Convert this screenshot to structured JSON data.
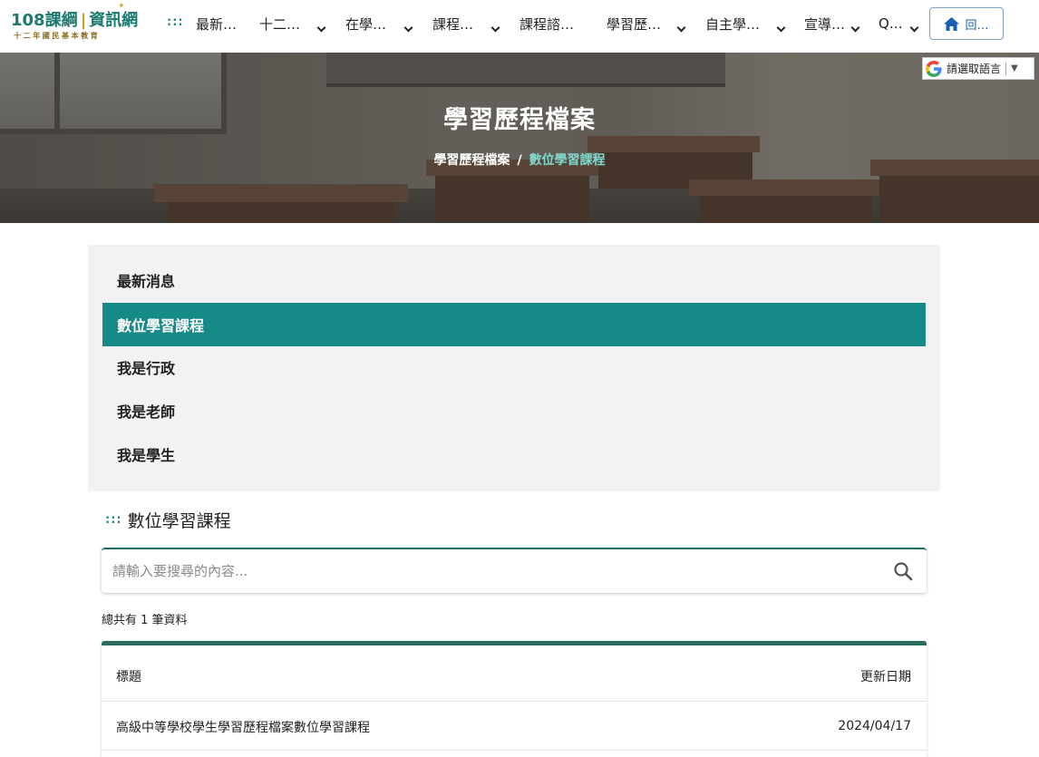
{
  "header": {
    "logo_main": "108課綱",
    "logo_main2": "資訊網",
    "logo_sub": "十二年國民基本教育",
    "nav_dots": ":::",
    "nav": [
      {
        "label": "最新…"
      },
      {
        "label": "十二…"
      },
      {
        "label": "在學…"
      },
      {
        "label": "課程…"
      },
      {
        "label": "課程諮…"
      },
      {
        "label": "學習歷…"
      },
      {
        "label": "自主學…"
      },
      {
        "label": "宣導…"
      },
      {
        "label": "Q…"
      }
    ],
    "home_label": "回…"
  },
  "banner": {
    "title": "學習歷程檔案",
    "breadcrumb": [
      "學習歷程檔案",
      "數位學習課程"
    ],
    "slash": "/"
  },
  "language": {
    "label": "請選取語言",
    "arrow": "▼"
  },
  "menu": {
    "items": [
      {
        "label": "最新消息",
        "active": false
      },
      {
        "label": "數位學習課程",
        "active": true
      },
      {
        "label": "我是行政",
        "active": false
      },
      {
        "label": "我是老師",
        "active": false
      },
      {
        "label": "我是學生",
        "active": false
      }
    ]
  },
  "section": {
    "dots": ":::",
    "title": "數位學習課程",
    "search_placeholder": "請輸入要搜尋的內容...",
    "count_text": "總共有 1 筆資料"
  },
  "table": {
    "headers": {
      "title": "標題",
      "date": "更新日期"
    },
    "rows": [
      {
        "title": "高級中等學校學生學習歷程檔案數位學習課程",
        "date": "2024/04/17"
      }
    ]
  },
  "colors": {
    "accent": "#168a87",
    "brand": "#1a7a70",
    "table_border": "#2b6e5e"
  }
}
